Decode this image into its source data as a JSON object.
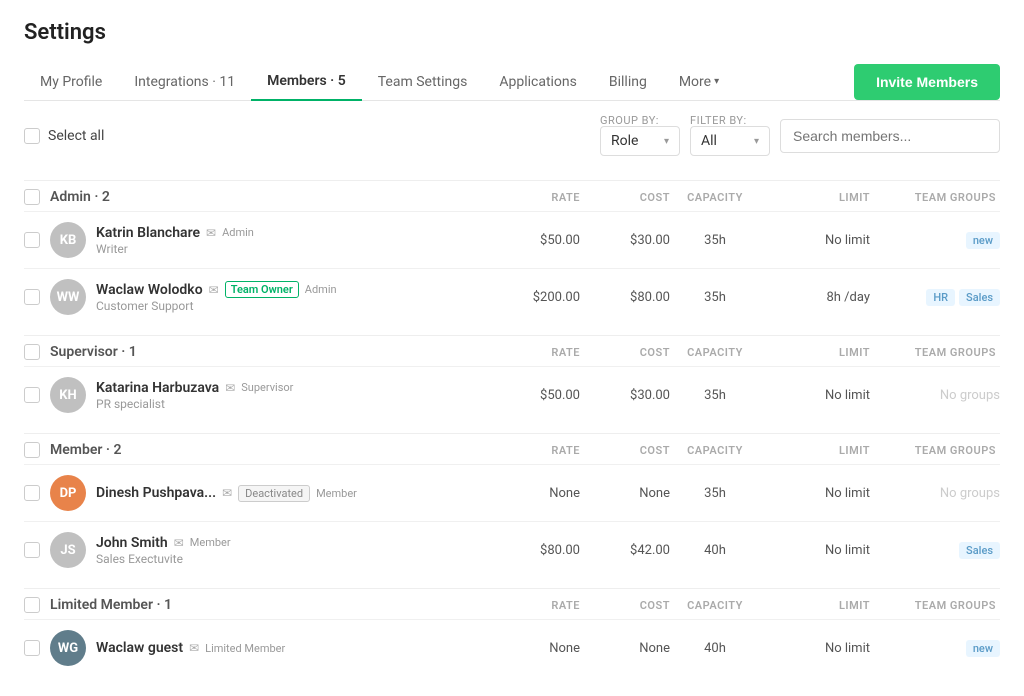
{
  "page": {
    "title": "Settings"
  },
  "nav": {
    "tabs": [
      {
        "id": "my-profile",
        "label": "My Profile",
        "count": null,
        "active": false
      },
      {
        "id": "integrations",
        "label": "Integrations",
        "count": "11",
        "active": false
      },
      {
        "id": "members",
        "label": "Members",
        "count": "5",
        "active": true
      },
      {
        "id": "team-settings",
        "label": "Team Settings",
        "count": null,
        "active": false
      },
      {
        "id": "applications",
        "label": "Applications",
        "count": null,
        "active": false
      },
      {
        "id": "billing",
        "label": "Billing",
        "count": null,
        "active": false
      },
      {
        "id": "more",
        "label": "More",
        "count": null,
        "active": false
      }
    ],
    "invite_button": "Invite Members"
  },
  "toolbar": {
    "select_all": "Select all",
    "group_by_label": "GROUP BY:",
    "group_by_value": "Role",
    "filter_by_label": "FILTER BY:",
    "filter_by_value": "All",
    "search_placeholder": "Search members..."
  },
  "sections": [
    {
      "id": "admin",
      "title": "Admin · 2",
      "col_headers": [
        "RATE",
        "COST",
        "CAPACITY",
        "LIMIT",
        "TEAM GROUPS"
      ],
      "members": [
        {
          "id": "katrin",
          "name": "Katrin Blanchare",
          "sub": "Writer",
          "role": "Admin",
          "team_owner": false,
          "deactivated": false,
          "rate": "$50.00",
          "cost": "$30.00",
          "capacity": "35h",
          "limit": "No limit",
          "groups": [
            "new"
          ],
          "avatar_color": "#b0b0b0",
          "avatar_initials": "KB",
          "avatar_type": "image"
        },
        {
          "id": "waclaw",
          "name": "Waclaw Wolodko",
          "sub": "Customer Support",
          "role": "Admin",
          "team_owner": true,
          "deactivated": false,
          "rate": "$200.00",
          "cost": "$80.00",
          "capacity": "35h",
          "limit": "8h /day",
          "groups": [
            "HR",
            "Sales"
          ],
          "avatar_color": "#b0b0b0",
          "avatar_initials": "WW",
          "avatar_type": "image"
        }
      ]
    },
    {
      "id": "supervisor",
      "title": "Supervisor · 1",
      "col_headers": [
        "RATE",
        "COST",
        "CAPACITY",
        "LIMIT",
        "TEAM GROUPS"
      ],
      "members": [
        {
          "id": "katarina",
          "name": "Katarina Harbuzava",
          "sub": "PR specialist",
          "role": "Supervisor",
          "team_owner": false,
          "deactivated": false,
          "rate": "$50.00",
          "cost": "$30.00",
          "capacity": "35h",
          "limit": "No limit",
          "groups": [],
          "groups_text": "No groups",
          "avatar_color": "#b0b0b0",
          "avatar_initials": "KH",
          "avatar_type": "image"
        }
      ]
    },
    {
      "id": "member",
      "title": "Member · 2",
      "col_headers": [
        "RATE",
        "COST",
        "CAPACITY",
        "LIMIT",
        "TEAM GROUPS"
      ],
      "members": [
        {
          "id": "dinesh",
          "name": "Dinesh Pushpava...",
          "sub": "",
          "role": "Member",
          "team_owner": false,
          "deactivated": true,
          "rate": "None",
          "cost": "None",
          "capacity": "35h",
          "limit": "No limit",
          "groups": [],
          "groups_text": "No groups",
          "avatar_color": "#e8834a",
          "avatar_initials": "DP",
          "avatar_type": "initials"
        },
        {
          "id": "john",
          "name": "John Smith",
          "sub": "Sales Exectuvite",
          "role": "Member",
          "team_owner": false,
          "deactivated": false,
          "rate": "$80.00",
          "cost": "$42.00",
          "capacity": "40h",
          "limit": "No limit",
          "groups": [
            "Sales"
          ],
          "avatar_color": "#b0b0b0",
          "avatar_initials": "JS",
          "avatar_type": "image"
        }
      ]
    },
    {
      "id": "limited-member",
      "title": "Limited Member · 1",
      "col_headers": [
        "RATE",
        "COST",
        "CAPACITY",
        "LIMIT",
        "TEAM GROUPS"
      ],
      "members": [
        {
          "id": "waclaw-guest",
          "name": "Waclaw guest",
          "sub": "",
          "role": "Limited Member",
          "team_owner": false,
          "deactivated": false,
          "rate": "None",
          "cost": "None",
          "capacity": "40h",
          "limit": "No limit",
          "groups": [
            "new"
          ],
          "avatar_color": "#607d8b",
          "avatar_initials": "WG",
          "avatar_type": "initials"
        }
      ]
    }
  ]
}
